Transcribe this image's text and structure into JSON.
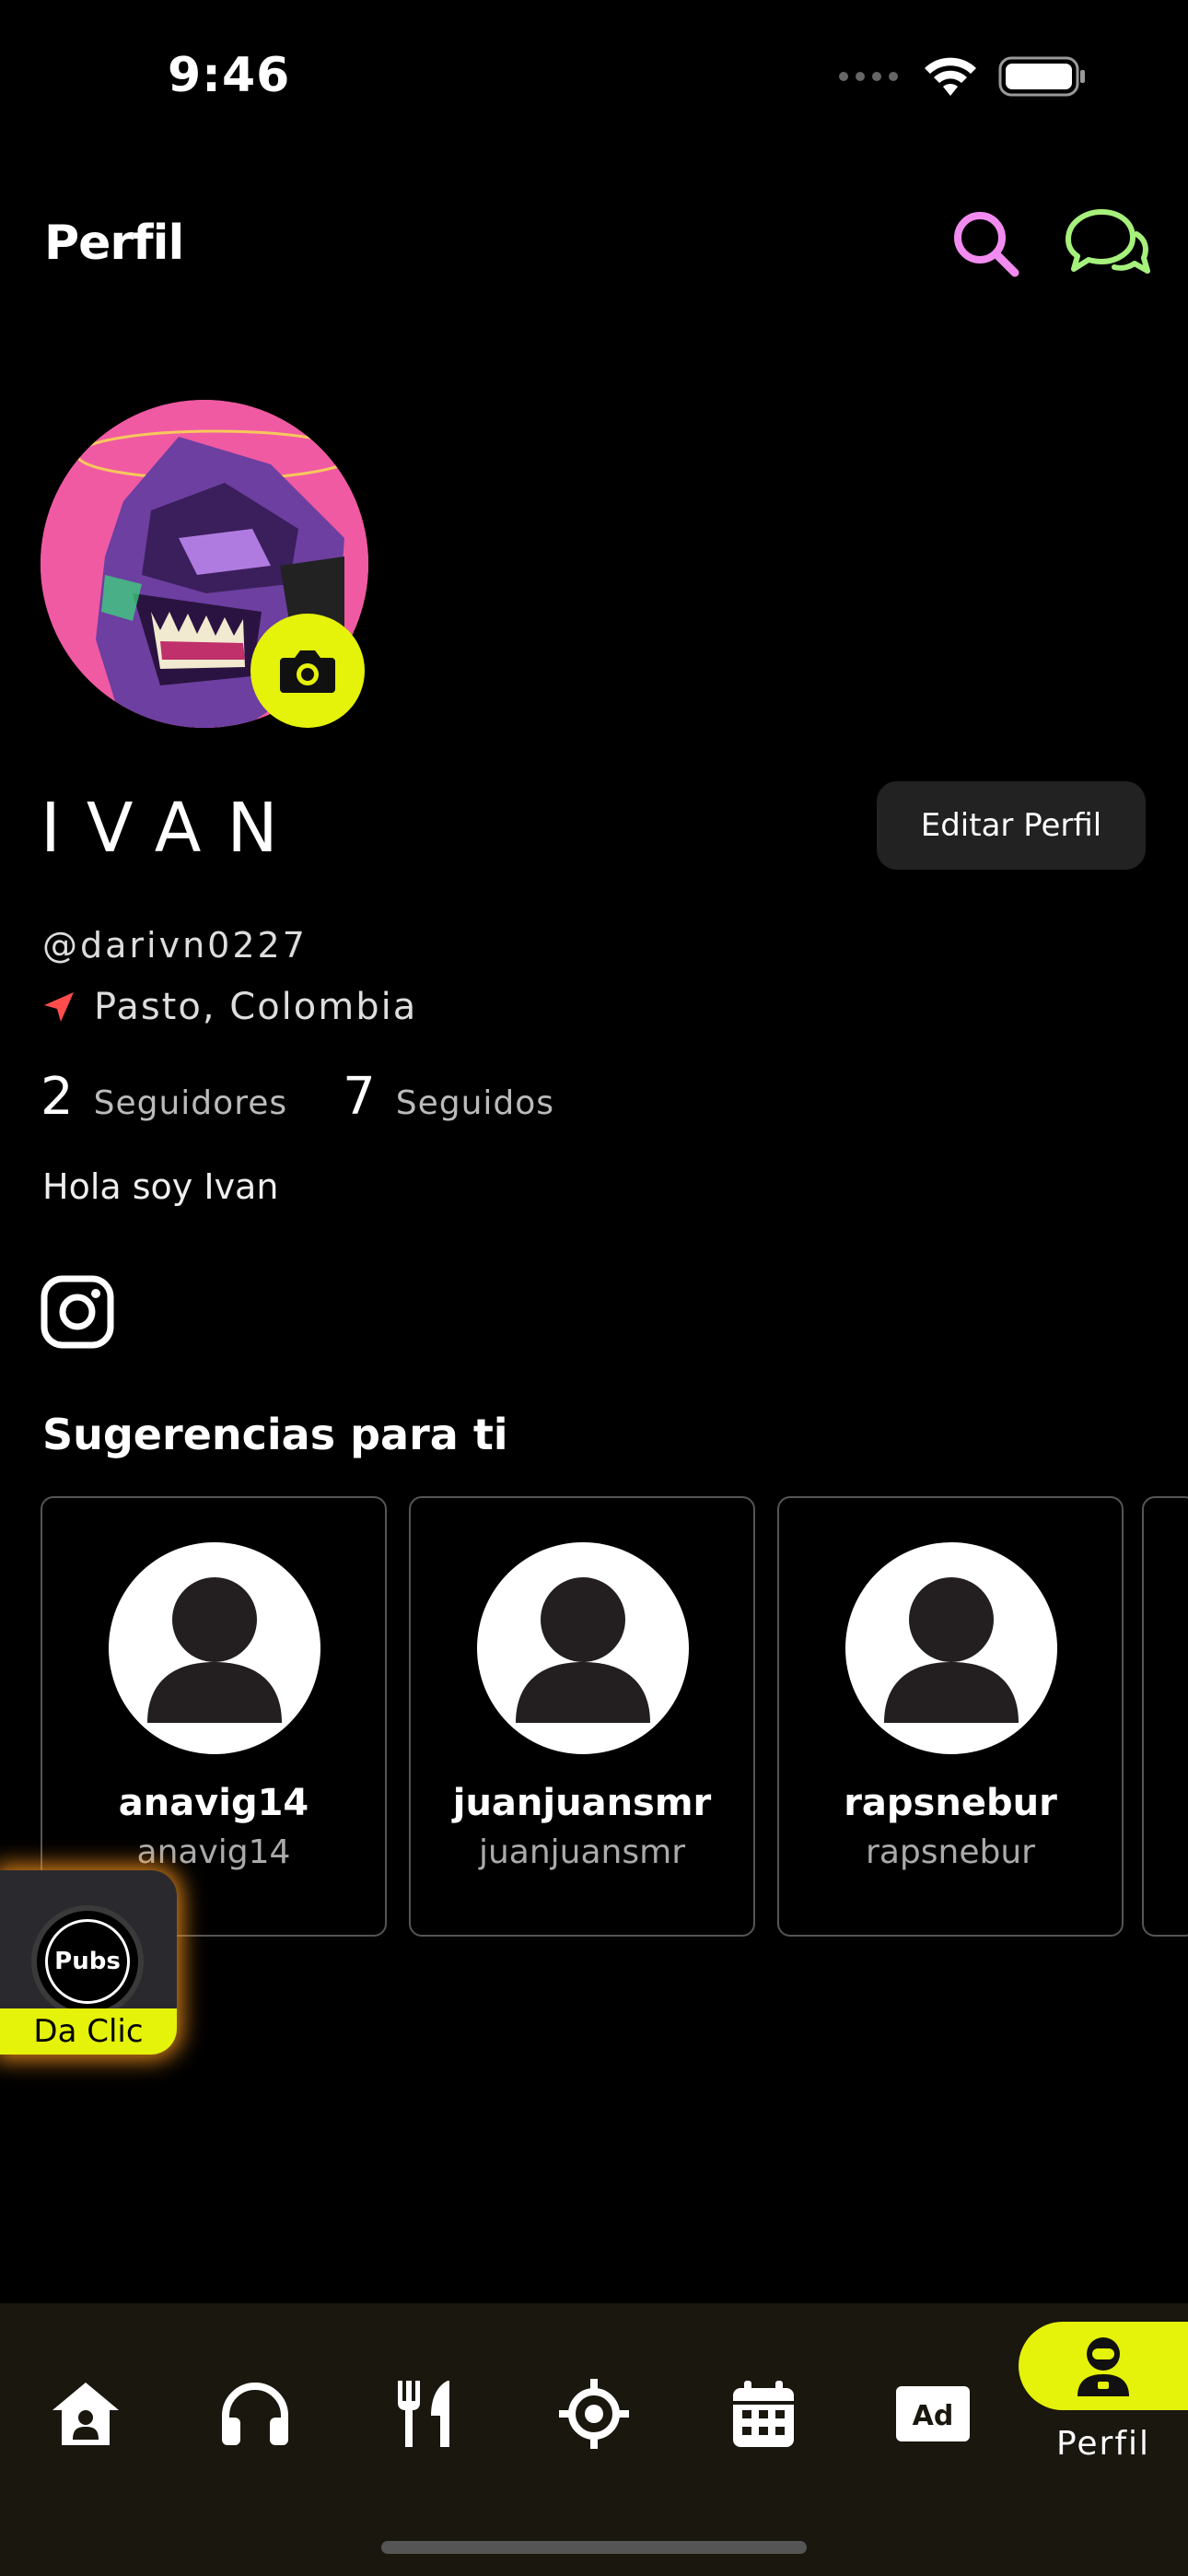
{
  "status": {
    "time": "9:46"
  },
  "header": {
    "title": "Perfil",
    "search_icon": "search-icon",
    "chat_icon": "chat-bubbles-icon",
    "accent_pink": "#f28bf0",
    "accent_green": "#a6f07c"
  },
  "profile": {
    "name": "IVAN",
    "edit_label": "Editar Perfil",
    "handle": "@darivn0227",
    "location": "Pasto, Colombia",
    "followers_count": "2",
    "followers_label": "Seguidores",
    "following_count": "7",
    "following_label": "Seguidos",
    "bio": "Hola soy Ivan"
  },
  "suggestions": {
    "title": "Sugerencias para ti",
    "items": [
      {
        "name": "anavig14",
        "username": "anavig14"
      },
      {
        "name": "juanjuansmr",
        "username": "juanjuansmr"
      },
      {
        "name": "rapsnebur",
        "username": "rapsnebur"
      }
    ]
  },
  "pubs": {
    "logo_text": "Pubs",
    "cta": "Da Clic"
  },
  "nav": {
    "items": [
      "home-icon",
      "headphones-icon",
      "utensils-icon",
      "target-icon",
      "calendar-icon",
      "ad-icon",
      "profile-icon"
    ],
    "active_label": "Perfil"
  },
  "colors": {
    "accent_yellow": "#e5f20a",
    "avatar_bg": "#f05aa3",
    "location_arrow": "#ff4d4d",
    "nav_bg": "#19170e"
  }
}
